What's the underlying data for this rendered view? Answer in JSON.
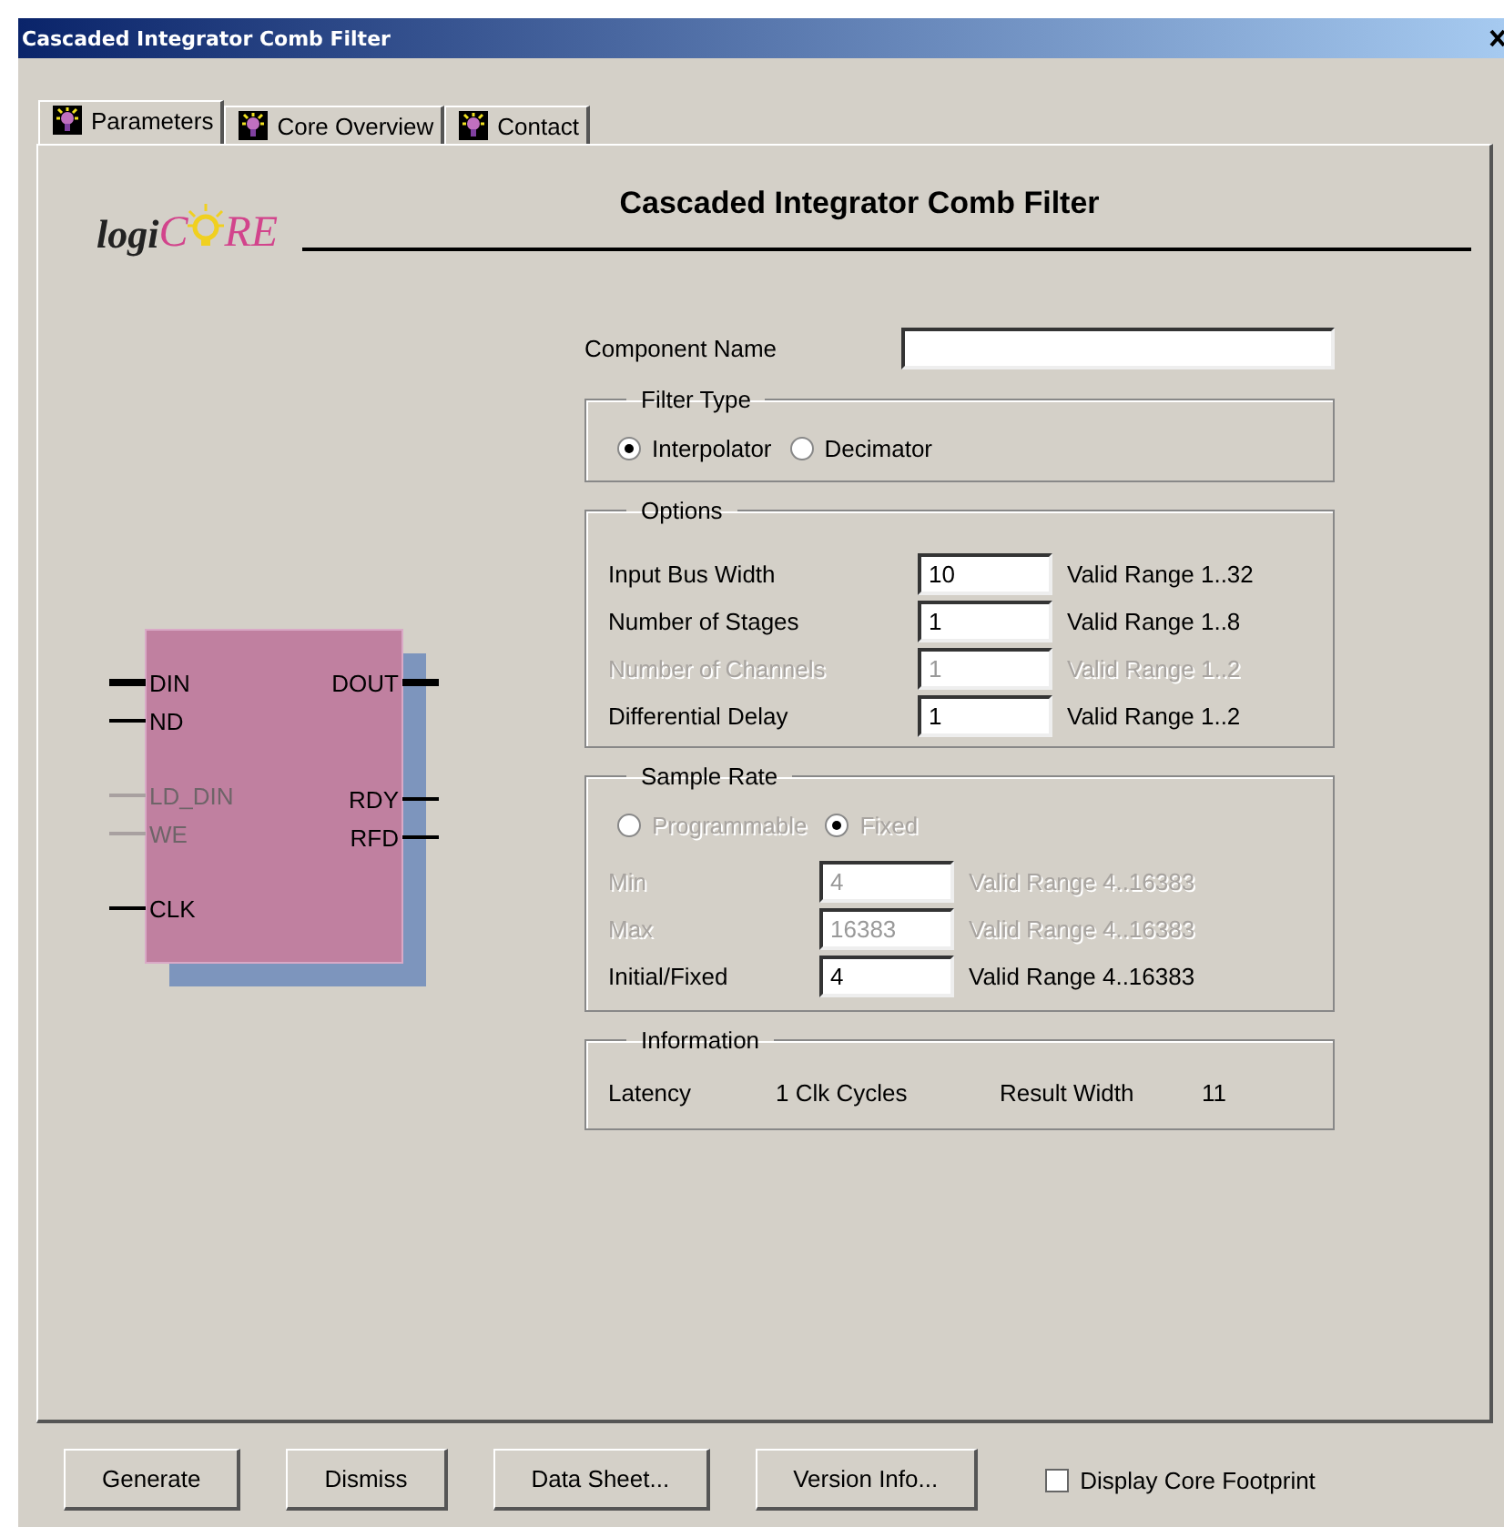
{
  "window": {
    "title": "Cascaded Integrator Comb Filter"
  },
  "tabs": [
    {
      "label": "Parameters",
      "selected": true
    },
    {
      "label": "Core Overview",
      "selected": false
    },
    {
      "label": "Contact",
      "selected": false
    }
  ],
  "logo": {
    "parts": [
      "logi",
      "C",
      "RE"
    ]
  },
  "heading": "Cascaded Integrator Comb Filter",
  "symbol": {
    "left_groups": [
      [
        {
          "name": "DIN",
          "bus": true,
          "disabled": false
        },
        {
          "name": "ND",
          "bus": false,
          "disabled": false
        }
      ],
      [
        {
          "name": "LD_DIN",
          "bus": false,
          "disabled": true
        },
        {
          "name": "WE",
          "bus": false,
          "disabled": true
        }
      ],
      [
        {
          "name": "CLK",
          "bus": false,
          "disabled": false
        }
      ]
    ],
    "right_groups": [
      [
        {
          "name": "DOUT",
          "bus": true,
          "disabled": false
        }
      ],
      [
        {
          "name": "RDY",
          "bus": false,
          "disabled": false
        },
        {
          "name": "RFD",
          "bus": false,
          "disabled": false
        }
      ]
    ]
  },
  "component_name": {
    "label": "Component Name"
  },
  "filter_type": {
    "title": "Filter Type",
    "options": [
      {
        "label": "Interpolator",
        "selected": true,
        "disabled": false
      },
      {
        "label": "Decimator",
        "selected": false,
        "disabled": false
      }
    ]
  },
  "options": {
    "title": "Options",
    "rows": [
      {
        "label": "Input Bus Width",
        "value": "10",
        "range": "Valid Range 1..32",
        "disabled": false
      },
      {
        "label": "Number of Stages",
        "value": "1",
        "range": "Valid Range 1..8",
        "disabled": false
      },
      {
        "label": "Number of Channels",
        "value": "1",
        "range": "Valid Range 1..2",
        "disabled": true
      },
      {
        "label": "Differential Delay",
        "value": "1",
        "range": "Valid Range 1..2",
        "disabled": false
      }
    ]
  },
  "sample_rate": {
    "title": "Sample Rate",
    "options": [
      {
        "label": "Programmable",
        "selected": false,
        "disabled": true
      },
      {
        "label": "Fixed",
        "selected": true,
        "disabled": true
      }
    ],
    "rows": [
      {
        "label": "Min",
        "value": "4",
        "range": "Valid Range 4..16383",
        "disabled": true
      },
      {
        "label": "Max",
        "value": "16383",
        "range": "Valid Range 4..16383",
        "disabled": true
      },
      {
        "label": "Initial/Fixed",
        "value": "4",
        "range": "Valid Range 4..16383",
        "disabled": false
      }
    ]
  },
  "information": {
    "title": "Information",
    "items": [
      "Latency",
      "1 Clk Cycles",
      "Result Width",
      "11"
    ]
  },
  "buttons": [
    "Generate",
    "Dismiss",
    "Data Sheet...",
    "Version Info..."
  ],
  "footprint": {
    "label": "Display Core Footprint",
    "checked": false
  }
}
